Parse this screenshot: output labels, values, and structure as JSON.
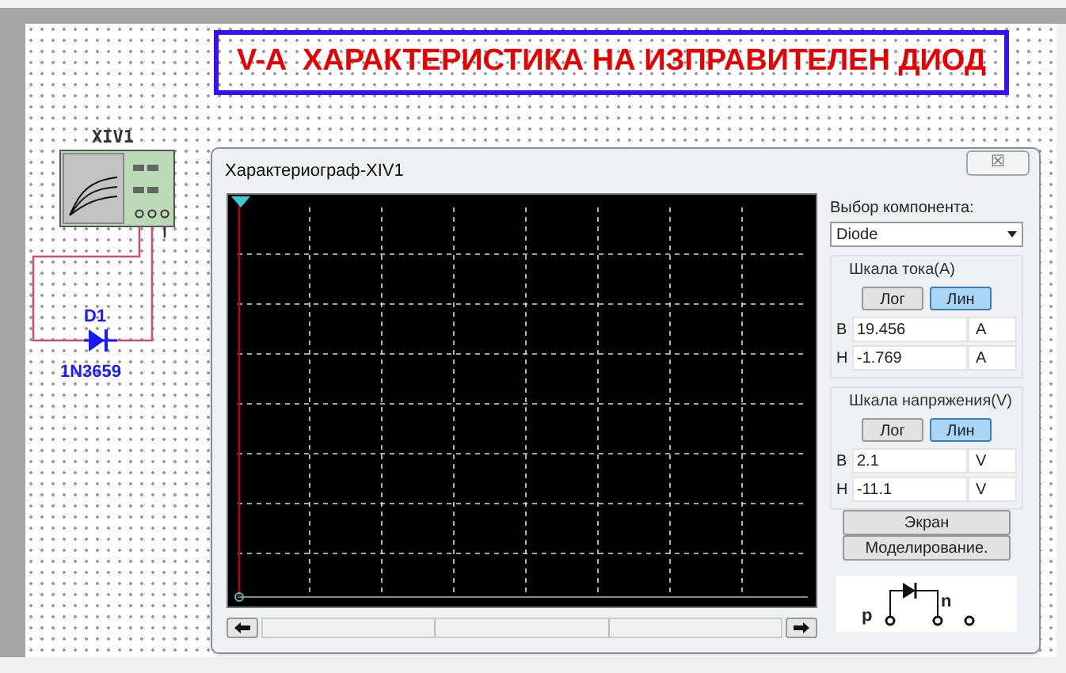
{
  "title_banner": "V-A  ХАРАКТЕРИСТИКА НА ИЗПРАВИТЕЛЕН ДИОД",
  "instrument": {
    "label": "XIV1"
  },
  "diode": {
    "ref": "D1",
    "model": "1N3659"
  },
  "dialog": {
    "title": "Характериограф-XIV1",
    "close": "☒",
    "component_label": "Выбор компонента:",
    "component_value": "Diode",
    "scales": [
      {
        "title": "Шкала тока(A)",
        "buttons": [
          {
            "label": "Лог",
            "selected": false
          },
          {
            "label": "Лин",
            "selected": true
          }
        ],
        "fields": [
          {
            "prefix": "В",
            "value": "19.456",
            "unit": "A"
          },
          {
            "prefix": "Н",
            "value": "-1.769",
            "unit": "A"
          }
        ]
      },
      {
        "title": "Шкала напряжения(V)",
        "buttons": [
          {
            "label": "Лог",
            "selected": false
          },
          {
            "label": "Лин",
            "selected": true
          }
        ],
        "fields": [
          {
            "prefix": "В",
            "value": "2.1",
            "unit": "V"
          },
          {
            "prefix": "Н",
            "value": "-11.1",
            "unit": "V"
          }
        ]
      }
    ],
    "actions": [
      "Экран",
      "Моделирование."
    ],
    "pin_labels": [
      "p",
      "n"
    ]
  }
}
